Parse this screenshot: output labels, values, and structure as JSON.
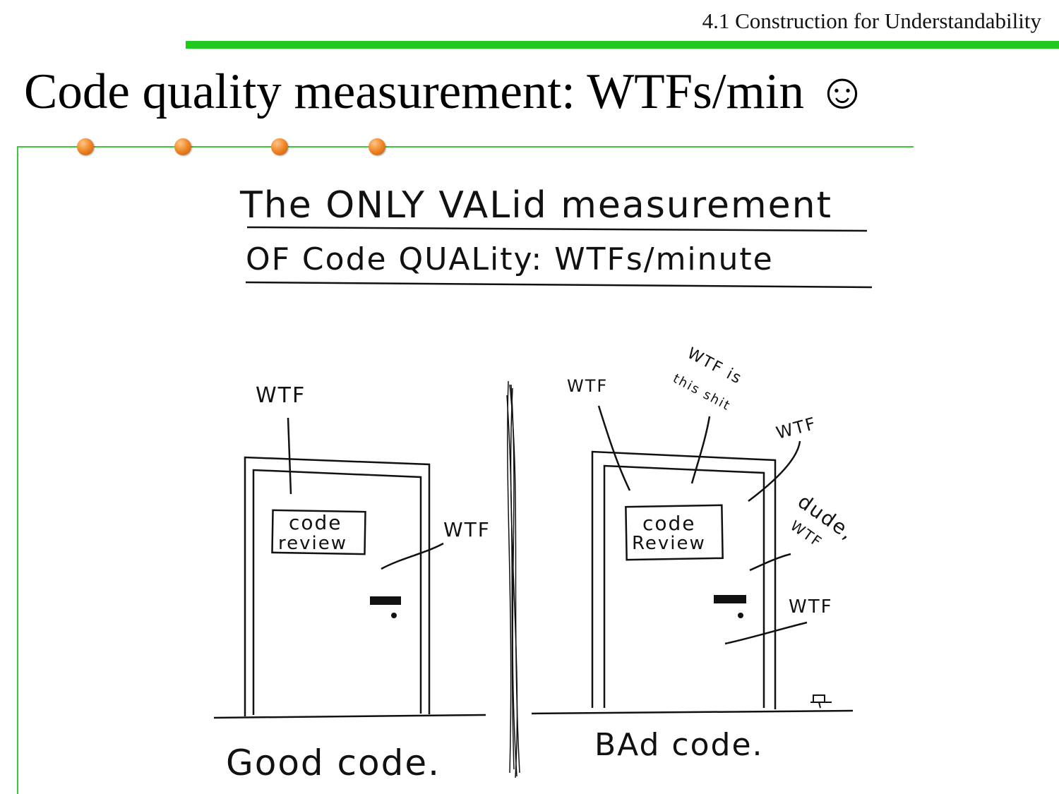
{
  "header": {
    "section_title": "4.1 Construction for Understandability"
  },
  "slide": {
    "title": "Code quality measurement: WTFs/min",
    "smiley": "☺"
  },
  "comic": {
    "caption_line1": "The ONLY VALid measurement",
    "caption_line2": "OF Code QUALity: WTFs/minute",
    "good_door": {
      "sign_line1": "code",
      "sign_line2": "review",
      "exclamations": [
        "WTF",
        "WTF"
      ],
      "label": "Good code."
    },
    "bad_door": {
      "sign_line1": "code",
      "sign_line2": "Review",
      "exclamations": [
        "WTF",
        "WTF is",
        "this shit",
        "WTF",
        "dude,",
        "WTF",
        "WTF"
      ],
      "label": "BAd code."
    }
  }
}
